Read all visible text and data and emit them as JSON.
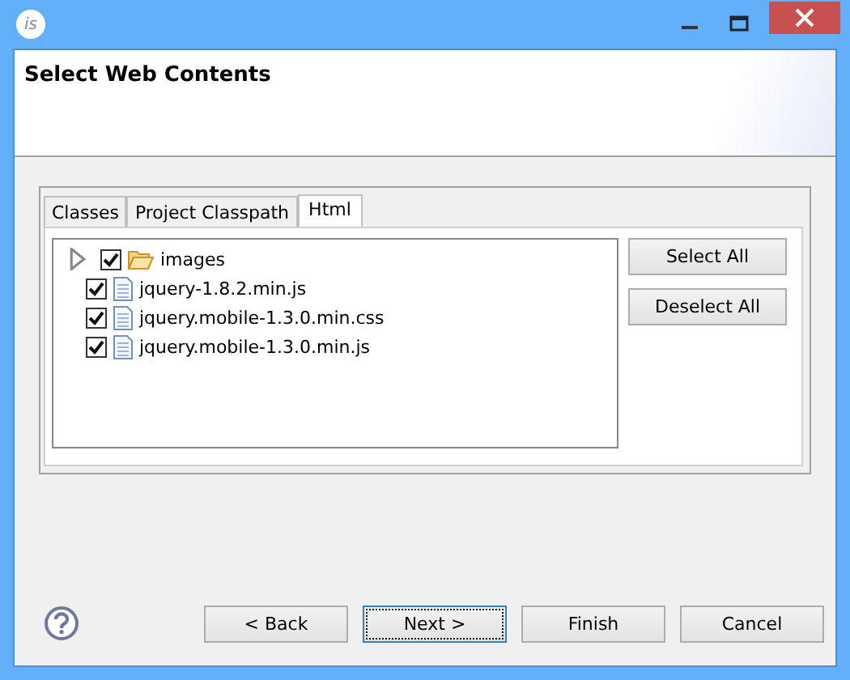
{
  "window": {
    "title_icon": "is"
  },
  "header": {
    "title": "Select Web Contents"
  },
  "tabs": [
    {
      "label": "Classes",
      "selected": false
    },
    {
      "label": "Project Classpath",
      "selected": false
    },
    {
      "label": "Html",
      "selected": true
    }
  ],
  "tree": [
    {
      "label": "images",
      "kind": "folder",
      "checked": true,
      "expanded": false
    },
    {
      "label": "jquery-1.8.2.min.js",
      "kind": "file",
      "checked": true
    },
    {
      "label": "jquery.mobile-1.3.0.min.css",
      "kind": "file",
      "checked": true
    },
    {
      "label": "jquery.mobile-1.3.0.min.js",
      "kind": "file",
      "checked": true
    }
  ],
  "side_buttons": [
    "Select All",
    "Deselect All"
  ],
  "footer_buttons": [
    {
      "label": "< Back",
      "focused": false
    },
    {
      "label": "Next >",
      "focused": true
    },
    {
      "label": "Finish",
      "focused": false
    },
    {
      "label": "Cancel",
      "focused": false
    }
  ]
}
